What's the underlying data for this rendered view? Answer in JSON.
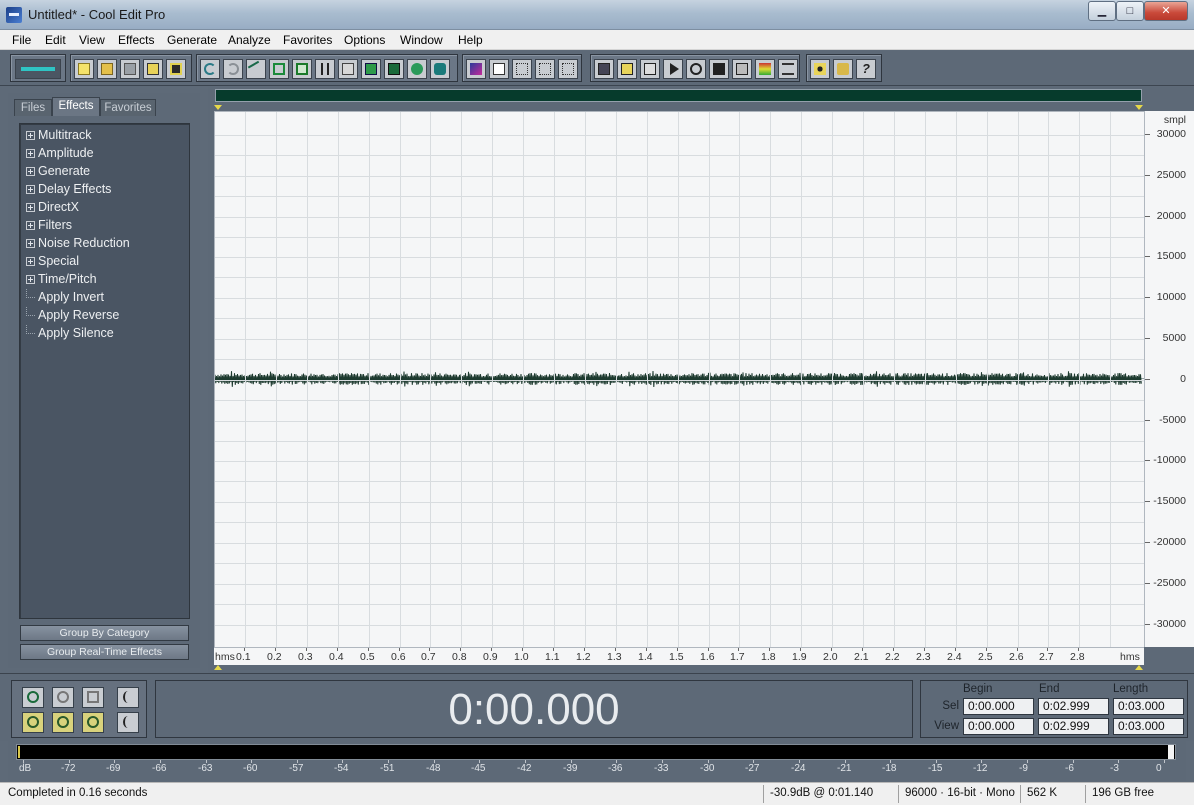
{
  "window": {
    "title": "Untitled* - Cool Edit Pro",
    "min": "▁",
    "max": "□",
    "close": "✕"
  },
  "menu": [
    "File",
    "Edit",
    "View",
    "Effects",
    "Generate",
    "Analyze",
    "Favorites",
    "Options",
    "Window",
    "Help"
  ],
  "panel": {
    "tabs": [
      "Files",
      "Effects",
      "Favorites"
    ],
    "active_tab": "Effects",
    "tree": [
      {
        "label": "Multitrack",
        "expandable": true
      },
      {
        "label": "Amplitude",
        "expandable": true
      },
      {
        "label": "Generate",
        "expandable": true
      },
      {
        "label": "Delay Effects",
        "expandable": true
      },
      {
        "label": "DirectX",
        "expandable": true
      },
      {
        "label": "Filters",
        "expandable": true
      },
      {
        "label": "Noise Reduction",
        "expandable": true
      },
      {
        "label": "Special",
        "expandable": true
      },
      {
        "label": "Time/Pitch",
        "expandable": true
      },
      {
        "label": "Apply Invert",
        "expandable": false
      },
      {
        "label": "Apply Reverse",
        "expandable": false
      },
      {
        "label": "Apply Silence",
        "expandable": false
      }
    ],
    "group_by_category": "Group By Category",
    "group_realtime": "Group Real-Time Effects"
  },
  "waveform": {
    "y_unit": "smpl",
    "y_labels": [
      "30000",
      "25000",
      "20000",
      "15000",
      "10000",
      "5000",
      "0",
      "-5000",
      "-10000",
      "-15000",
      "-20000",
      "-25000",
      "-30000"
    ],
    "x_unit_left": "hms",
    "x_unit_right": "hms",
    "x_labels": [
      "0.1",
      "0.2",
      "0.3",
      "0.4",
      "0.5",
      "0.6",
      "0.7",
      "0.8",
      "0.9",
      "1.0",
      "1.1",
      "1.2",
      "1.3",
      "1.4",
      "1.5",
      "1.6",
      "1.7",
      "1.8",
      "1.9",
      "2.0",
      "2.1",
      "2.2",
      "2.3",
      "2.4",
      "2.5",
      "2.6",
      "2.7",
      "2.8"
    ],
    "wave_color": "#1d3a2f",
    "overview_color": "#063b2c"
  },
  "time_display": "0:00.000",
  "selection": {
    "headers": [
      "Begin",
      "End",
      "Length"
    ],
    "sel_label": "Sel",
    "view_label": "View",
    "sel": [
      "0:00.000",
      "0:02.999",
      "0:03.000"
    ],
    "view": [
      "0:00.000",
      "0:02.999",
      "0:03.000"
    ]
  },
  "meter": {
    "labels": [
      "dB",
      "-72",
      "-69",
      "-66",
      "-63",
      "-60",
      "-57",
      "-54",
      "-51",
      "-48",
      "-45",
      "-42",
      "-39",
      "-36",
      "-33",
      "-30",
      "-27",
      "-24",
      "-21",
      "-18",
      "-15",
      "-12",
      "-9",
      "-6",
      "-3",
      "0"
    ]
  },
  "status": {
    "message": "Completed in 0.16 seconds",
    "level_time": "-30.9dB @  0:01.140",
    "format": "96000 · 16-bit · Mono",
    "size": "562 K",
    "free": "196 GB free"
  }
}
